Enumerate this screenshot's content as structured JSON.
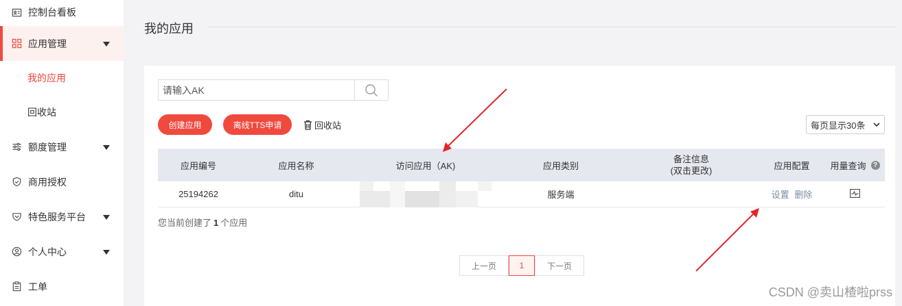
{
  "sidebar": {
    "items": [
      {
        "label": "控制台看板",
        "icon": "id-card-icon"
      },
      {
        "label": "应用管理",
        "icon": "grid-icon"
      },
      {
        "label": "我的应用"
      },
      {
        "label": "回收站"
      },
      {
        "label": "额度管理",
        "icon": "sliders-icon"
      },
      {
        "label": "商用授权",
        "icon": "shield-check-icon"
      },
      {
        "label": "特色服务平台",
        "icon": "heart-shield-icon"
      },
      {
        "label": "个人中心",
        "icon": "user-icon"
      },
      {
        "label": "工单",
        "icon": "clipboard-icon"
      }
    ]
  },
  "page": {
    "title": "我的应用"
  },
  "search": {
    "placeholder": "请输入AK"
  },
  "toolbar": {
    "create_label": "创建应用",
    "tts_label": "离线TTS申请",
    "recycle_label": "回收站",
    "page_size_label": "每页显示30条"
  },
  "table": {
    "headers": [
      "应用编号",
      "应用名称",
      "访问应用（AK)",
      "应用类别",
      "备注信息",
      "(双击更改)",
      "应用配置",
      "用量查询"
    ],
    "rows": [
      {
        "id": "25194262",
        "name": "ditu",
        "category": "服务端",
        "note": "",
        "settings": "设置",
        "delete": "删除"
      }
    ]
  },
  "summary": {
    "prefix": "您当前创建了",
    "count": "1",
    "suffix": "个应用"
  },
  "pagination": {
    "prev": "上一页",
    "current": "1",
    "next": "下一页"
  },
  "watermark": "CSDN @卖山楂啦prss",
  "colors": {
    "accent": "#f0493d",
    "annotation_arrow": "#e0262b"
  }
}
